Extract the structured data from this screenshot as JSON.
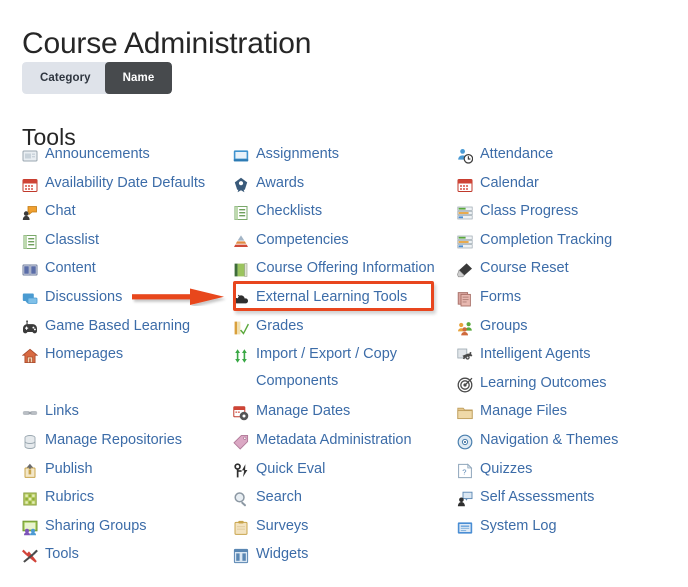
{
  "page": {
    "title": "Course Administration",
    "section_heading": "Tools"
  },
  "toggle": {
    "options": [
      {
        "label": "Category",
        "active": false
      },
      {
        "label": "Name",
        "active": true
      }
    ],
    "active_bg": "#474a4d",
    "inactive_bg": "#dfe3ea"
  },
  "annotation": {
    "color": "#e8461e",
    "highlighted_item": "External Learning Tools",
    "arrow": "right-arrow"
  },
  "link_color": "#3c6ca8",
  "columns": [
    {
      "items": [
        {
          "label": "Announcements",
          "icon": "announcements-icon"
        },
        {
          "label": "Availability Date Defaults",
          "icon": "calendar-red-icon"
        },
        {
          "label": "Chat",
          "icon": "chat-icon"
        },
        {
          "label": "Classlist",
          "icon": "classlist-icon"
        },
        {
          "label": "Content",
          "icon": "book-icon"
        },
        {
          "label": "Discussions",
          "icon": "discussions-icon"
        },
        {
          "label": "Game Based Learning",
          "icon": "game-controller-icon"
        },
        {
          "label": "Homepages",
          "icon": "home-icon"
        },
        {
          "label": "",
          "icon": "spacer"
        },
        {
          "label": "Links",
          "icon": "links-icon"
        },
        {
          "label": "Manage Repositories",
          "icon": "database-icon"
        },
        {
          "label": "Publish",
          "icon": "publish-icon"
        },
        {
          "label": "Rubrics",
          "icon": "rubrics-icon"
        },
        {
          "label": "Sharing Groups",
          "icon": "sharing-groups-icon"
        },
        {
          "label": "Tools",
          "icon": "tools-icon"
        }
      ]
    },
    {
      "items": [
        {
          "label": "Assignments",
          "icon": "assignments-icon"
        },
        {
          "label": "Awards",
          "icon": "awards-icon"
        },
        {
          "label": "Checklists",
          "icon": "checklists-icon"
        },
        {
          "label": "Competencies",
          "icon": "competencies-icon"
        },
        {
          "label": "Course Offering Information",
          "icon": "course-offering-icon"
        },
        {
          "label": "External Learning Tools",
          "icon": "external-learning-tools-icon"
        },
        {
          "label": "Grades",
          "icon": "grades-icon"
        },
        {
          "label": "Import / Export / Copy Components",
          "icon": "import-export-icon"
        },
        {
          "label": "Manage Dates",
          "icon": "manage-dates-icon"
        },
        {
          "label": "Metadata Administration",
          "icon": "tag-icon"
        },
        {
          "label": "Quick Eval",
          "icon": "quick-eval-icon"
        },
        {
          "label": "Search",
          "icon": "search-icon"
        },
        {
          "label": "Surveys",
          "icon": "surveys-icon"
        },
        {
          "label": "Widgets",
          "icon": "widgets-icon"
        }
      ]
    },
    {
      "items": [
        {
          "label": "Attendance",
          "icon": "attendance-icon"
        },
        {
          "label": "Calendar",
          "icon": "calendar-red-icon"
        },
        {
          "label": "Class Progress",
          "icon": "class-progress-icon"
        },
        {
          "label": "Completion Tracking",
          "icon": "completion-tracking-icon"
        },
        {
          "label": "Course Reset",
          "icon": "eraser-icon"
        },
        {
          "label": "Forms",
          "icon": "forms-icon"
        },
        {
          "label": "Groups",
          "icon": "groups-icon"
        },
        {
          "label": "Intelligent Agents",
          "icon": "gear-icon"
        },
        {
          "label": "Learning Outcomes",
          "icon": "target-icon"
        },
        {
          "label": "Manage Files",
          "icon": "folder-icon"
        },
        {
          "label": "Navigation & Themes",
          "icon": "navigation-icon"
        },
        {
          "label": "Quizzes",
          "icon": "quizzes-icon"
        },
        {
          "label": "Self Assessments",
          "icon": "self-assessments-icon"
        },
        {
          "label": "System Log",
          "icon": "system-log-icon"
        }
      ]
    }
  ]
}
